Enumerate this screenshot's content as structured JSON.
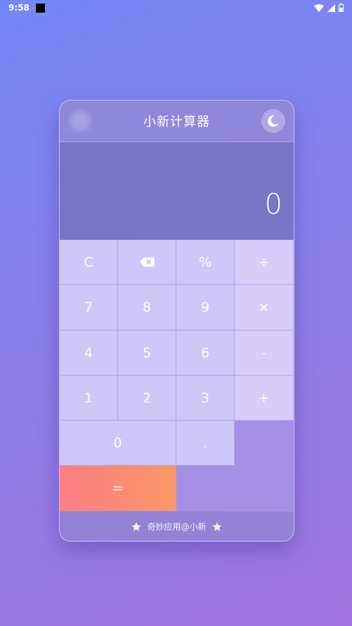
{
  "status_bar": {
    "time": "9:58",
    "icons": [
      "app-notification-icon",
      "wifi-icon",
      "signal-icon",
      "battery-icon"
    ]
  },
  "app": {
    "title": "小新计算器",
    "theme_toggle_icon": "moon-icon"
  },
  "display": {
    "value": "0"
  },
  "keys": {
    "clear": "C",
    "backspace_icon": "backspace-icon",
    "percent": "%",
    "divide": "÷",
    "seven": "7",
    "eight": "8",
    "nine": "9",
    "multiply": "×",
    "four": "4",
    "five": "5",
    "six": "6",
    "subtract": "-",
    "one": "1",
    "two": "2",
    "three": "3",
    "add": "+",
    "zero": "0",
    "dot": ".",
    "equals": "="
  },
  "footer": {
    "text": "奇妙应用@小新",
    "icon": "star-icon"
  },
  "colors": {
    "background_start": "#7488f5",
    "background_end": "#a276de",
    "equals_start": "#fb7e83",
    "equals_end": "#fc9768"
  }
}
